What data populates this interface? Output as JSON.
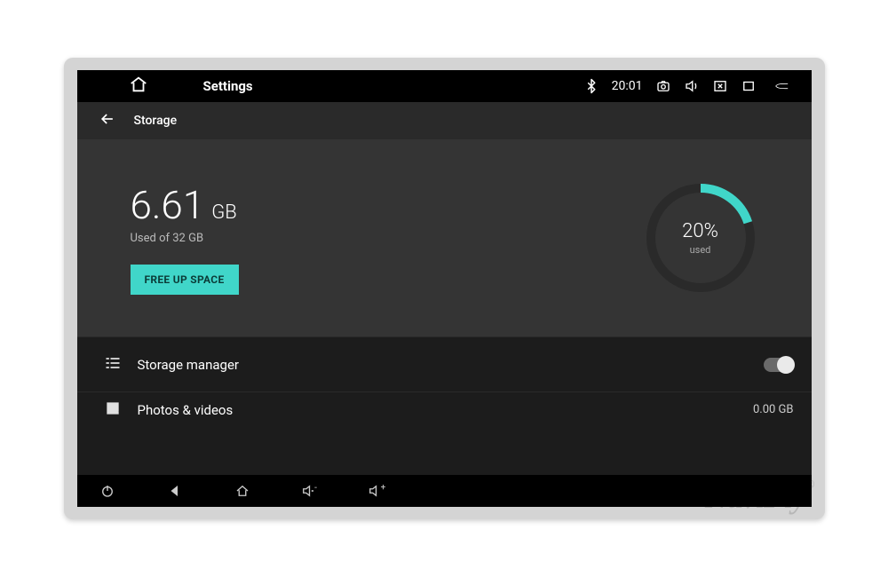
{
  "statusbar": {
    "title": "Settings",
    "clock": "20:01"
  },
  "subheader": {
    "title": "Storage"
  },
  "storage": {
    "used_value": "6.61",
    "used_unit": "GB",
    "used_of": "Used of 32 GB",
    "free_up_label": "FREE UP SPACE",
    "percent_text": "20%",
    "percent_label": "used",
    "percent_numeric": 20
  },
  "rows": {
    "storage_manager": {
      "label": "Storage manager",
      "toggled": false
    },
    "photos": {
      "label": "Photos & videos",
      "value": "0.00 GB"
    }
  },
  "watermark": "NaviFly"
}
